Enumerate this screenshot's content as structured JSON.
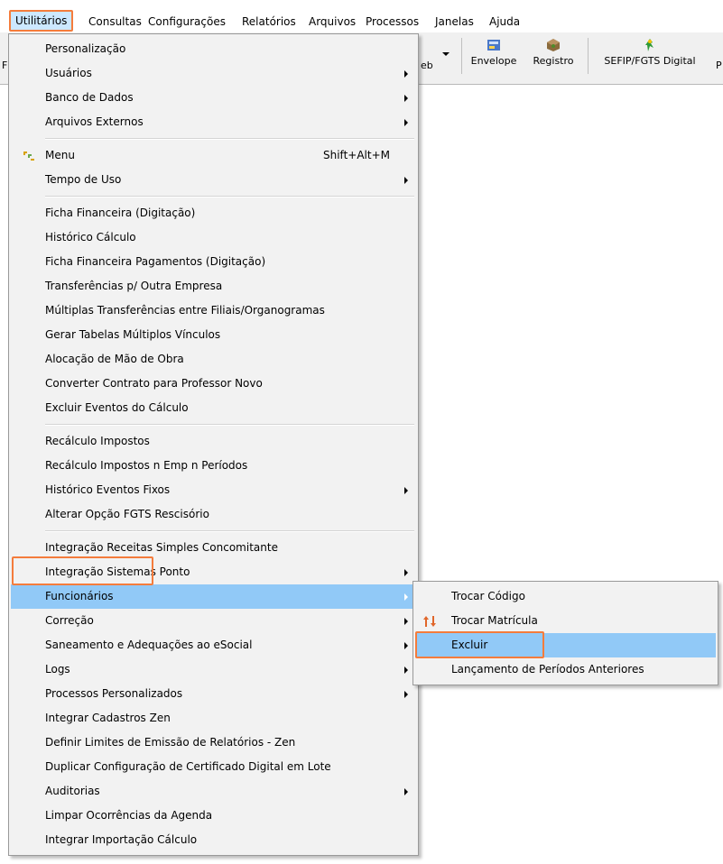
{
  "menubar": {
    "items": [
      "Utilitários",
      "Consultas",
      "Configurações",
      "Relatórios",
      "Arquivos",
      "Processos",
      "Janelas",
      "Ajuda"
    ],
    "active_index": 0
  },
  "toolbar": {
    "left_fragment": "F",
    "web_fragment": "eb",
    "buttons": [
      {
        "label": "Envelope",
        "icon": "envelope-icon"
      },
      {
        "label": "Registro",
        "icon": "registry-icon"
      },
      {
        "label": "SEFIP/FGTS Digital",
        "icon": "sefip-icon"
      }
    ],
    "right_fragment": "P"
  },
  "menu": {
    "items": [
      {
        "label": "Personalização"
      },
      {
        "label": "Usuários",
        "submenu": true
      },
      {
        "label": "Banco de Dados",
        "submenu": true
      },
      {
        "label": "Arquivos Externos",
        "submenu": true
      },
      {
        "label": "Menu",
        "shortcut": "Shift+Alt+M",
        "icon": "menu-icon"
      },
      {
        "label": "Tempo de Uso",
        "submenu": true
      },
      {
        "label": "Ficha Financeira (Digitação)"
      },
      {
        "label": "Histórico Cálculo"
      },
      {
        "label": "Ficha Financeira Pagamentos (Digitação)"
      },
      {
        "label": "Transferências p/ Outra Empresa"
      },
      {
        "label": "Múltiplas Transferências entre Filiais/Organogramas"
      },
      {
        "label": "Gerar Tabelas Múltiplos Vínculos"
      },
      {
        "label": "Alocação de Mão de Obra"
      },
      {
        "label": "Converter Contrato para Professor Novo"
      },
      {
        "label": "Excluir Eventos do Cálculo"
      },
      {
        "label": "Recálculo Impostos"
      },
      {
        "label": "Recálculo Impostos n Emp n Períodos"
      },
      {
        "label": "Histórico Eventos Fixos",
        "submenu": true
      },
      {
        "label": "Alterar Opção FGTS Rescisório"
      },
      {
        "label": "Integração Receitas Simples Concomitante"
      },
      {
        "label": "Integração Sistemas Ponto",
        "submenu": true
      },
      {
        "label": "Funcionários",
        "submenu": true,
        "highlighted": true
      },
      {
        "label": "Correção",
        "submenu": true
      },
      {
        "label": "Saneamento e Adequações ao eSocial",
        "submenu": true
      },
      {
        "label": "Logs",
        "submenu": true
      },
      {
        "label": "Processos Personalizados",
        "submenu": true
      },
      {
        "label": "Integrar Cadastros Zen"
      },
      {
        "label": "Definir Limites de Emissão de Relatórios - Zen"
      },
      {
        "label": "Duplicar Configuração de Certificado Digital em Lote"
      },
      {
        "label": "Auditorias",
        "submenu": true
      },
      {
        "label": "Limpar Ocorrências da Agenda"
      },
      {
        "label": "Integrar Importação Cálculo"
      }
    ]
  },
  "submenu": {
    "items": [
      {
        "label": "Trocar Código"
      },
      {
        "label": "Trocar Matrícula",
        "icon": "swap-arrows-icon"
      },
      {
        "label": "Excluir",
        "highlighted": true
      },
      {
        "label": "Lançamento de Períodos Anteriores"
      }
    ]
  },
  "colors": {
    "highlight": "#91c9f7",
    "callout_border": "#f47c3c",
    "menu_bg": "#f2f2f2"
  }
}
